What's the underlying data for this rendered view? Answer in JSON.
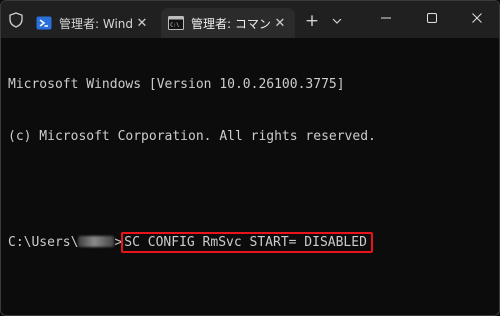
{
  "titlebar": {
    "tabs": [
      {
        "label": "管理者: Windows PowerShell",
        "icon": "powershell-icon",
        "active": false
      },
      {
        "label": "管理者: コマンド プロンプト",
        "icon": "cmd-icon",
        "active": true
      }
    ],
    "new_tab_icon": "plus-icon",
    "dropdown_icon": "chevron-down-icon",
    "window_controls": [
      "minimize-icon",
      "maximize-icon",
      "close-icon"
    ]
  },
  "terminal": {
    "lines": [
      "Microsoft Windows [Version 10.0.26100.3775]",
      "(c) Microsoft Corporation. All rights reserved."
    ],
    "prompt_prefix": "C:\\Users\\",
    "prompt_suffix": ">",
    "command": "SC CONFIG RmSvc START= DISABLED"
  },
  "colors": {
    "background": "#0c0c0c",
    "titlebar": "#202020",
    "active_tab": "#2b2b2b",
    "text": "#cccccc",
    "highlight_box": "#e8141a",
    "powershell_icon": "#2a6fdb"
  }
}
